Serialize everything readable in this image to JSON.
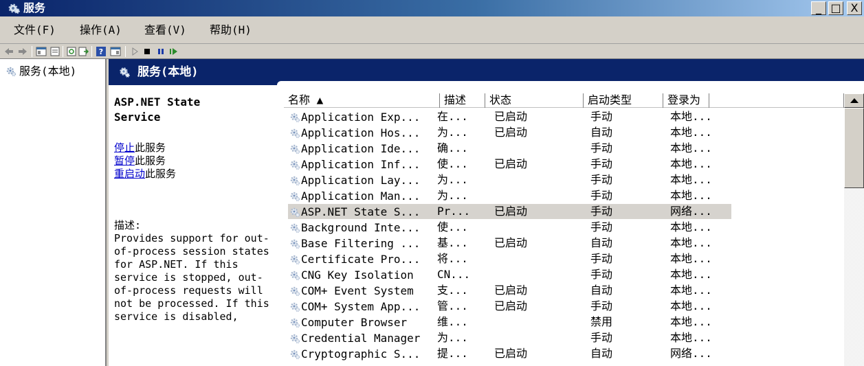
{
  "window": {
    "title": "服务",
    "minimize": "_",
    "maximize": "□",
    "close": "X"
  },
  "menu": [
    "文件(F)",
    "操作(A)",
    "查看(V)",
    "帮助(H)"
  ],
  "tree": {
    "root_label": "服务(本地)"
  },
  "pane_header": {
    "title": "服务(本地)"
  },
  "details": {
    "service_name": "ASP.NET State Service",
    "actions": [
      {
        "link": "停止",
        "suffix": "此服务"
      },
      {
        "link": "暂停",
        "suffix": "此服务"
      },
      {
        "link": "重启动",
        "suffix": "此服务"
      }
    ],
    "description_label": "描述:",
    "description": "Provides support for out-of-process session states for ASP.NET. If this service is stopped, out-of-process requests will not be processed. If this service is disabled,"
  },
  "list": {
    "columns": [
      "名称 ▲",
      "描述",
      "状态",
      "启动类型",
      "登录为"
    ],
    "rows": [
      {
        "name": "Application Exp...",
        "desc": "在...",
        "status": "已启动",
        "startup": "手动",
        "logon": "本地..."
      },
      {
        "name": "Application Hos...",
        "desc": "为...",
        "status": "已启动",
        "startup": "自动",
        "logon": "本地..."
      },
      {
        "name": "Application Ide...",
        "desc": "确...",
        "status": "",
        "startup": "手动",
        "logon": "本地..."
      },
      {
        "name": "Application Inf...",
        "desc": "使...",
        "status": "已启动",
        "startup": "手动",
        "logon": "本地..."
      },
      {
        "name": "Application Lay...",
        "desc": "为...",
        "status": "",
        "startup": "手动",
        "logon": "本地..."
      },
      {
        "name": "Application Man...",
        "desc": "为...",
        "status": "",
        "startup": "手动",
        "logon": "本地..."
      },
      {
        "name": "ASP.NET State S...",
        "desc": "Pr...",
        "status": "已启动",
        "startup": "手动",
        "logon": "网络...",
        "selected": true
      },
      {
        "name": "Background Inte...",
        "desc": "使...",
        "status": "",
        "startup": "手动",
        "logon": "本地..."
      },
      {
        "name": "Base Filtering ...",
        "desc": "基...",
        "status": "已启动",
        "startup": "自动",
        "logon": "本地..."
      },
      {
        "name": "Certificate Pro...",
        "desc": "将...",
        "status": "",
        "startup": "手动",
        "logon": "本地..."
      },
      {
        "name": "CNG Key Isolation",
        "desc": "CN...",
        "status": "",
        "startup": "手动",
        "logon": "本地..."
      },
      {
        "name": "COM+ Event System",
        "desc": "支...",
        "status": "已启动",
        "startup": "自动",
        "logon": "本地..."
      },
      {
        "name": "COM+ System App...",
        "desc": "管...",
        "status": "已启动",
        "startup": "手动",
        "logon": "本地..."
      },
      {
        "name": "Computer Browser",
        "desc": "维...",
        "status": "",
        "startup": "禁用",
        "logon": "本地..."
      },
      {
        "name": "Credential Manager",
        "desc": "为...",
        "status": "",
        "startup": "手动",
        "logon": "本地..."
      },
      {
        "name": "Cryptographic S...",
        "desc": "提...",
        "status": "已启动",
        "startup": "自动",
        "logon": "网络..."
      }
    ]
  },
  "colors": {
    "title_gradient_start": "#0a246a",
    "header_band": "#0a246a",
    "selected_row": "#d6d3ce",
    "link": "#0000cc"
  }
}
